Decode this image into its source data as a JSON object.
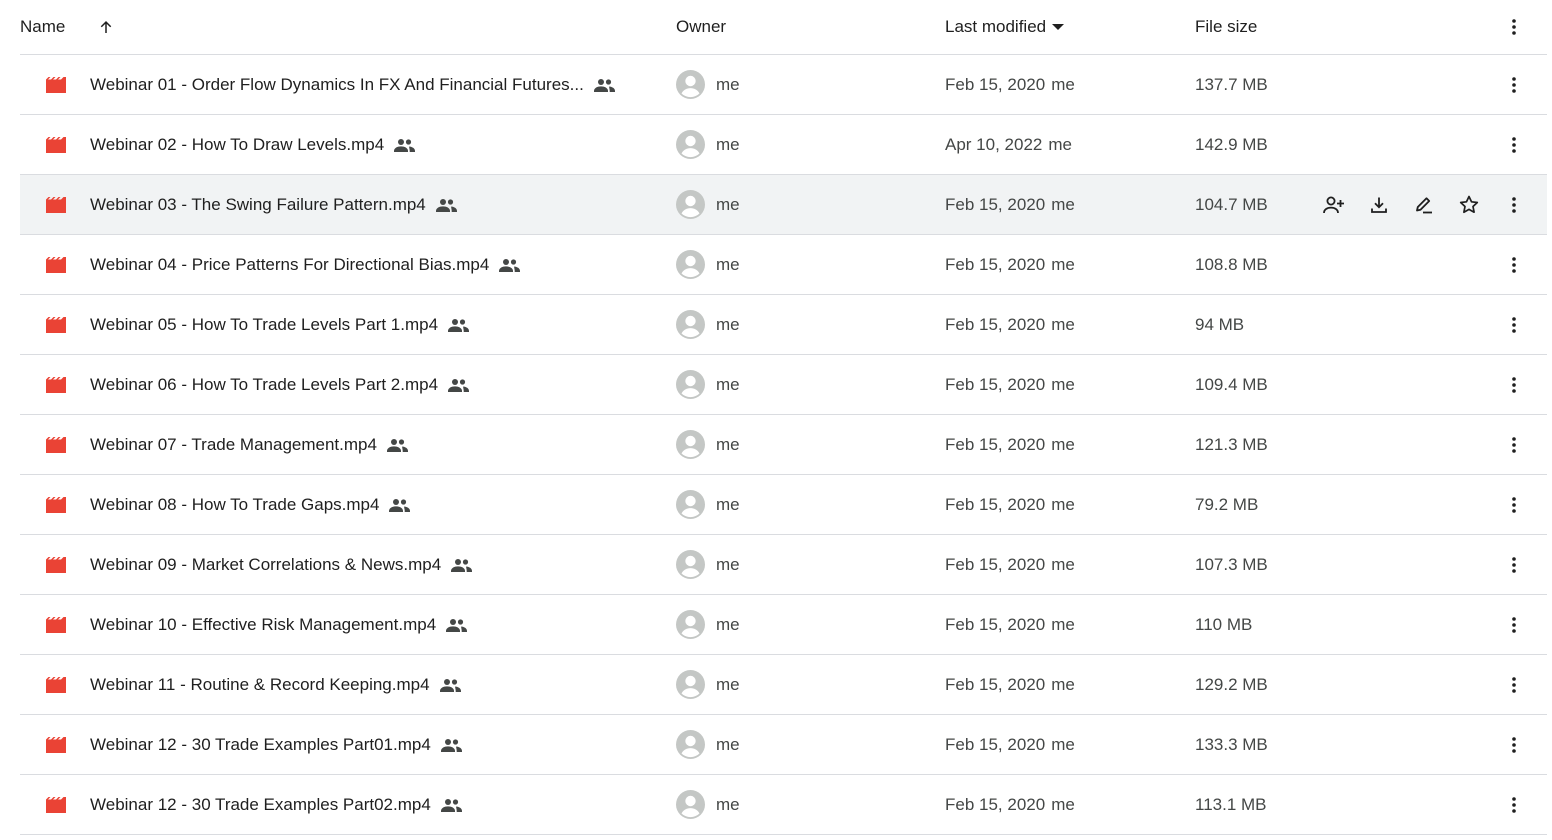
{
  "header": {
    "name_label": "Name",
    "owner_label": "Owner",
    "modified_label": "Last modified",
    "size_label": "File size",
    "sort_icon": "arrow-up-icon",
    "modified_dropdown_icon": "caret-down-icon",
    "more_icon": "more-vert-icon"
  },
  "colors": {
    "video_icon": "#ea4335",
    "row_hover_bg": "#f1f3f4",
    "divider": "#dadce0",
    "avatar": "#c4c7c5"
  },
  "files": [
    {
      "name": "Webinar 01 -  Order Flow Dynamics In FX And Financial Futures...",
      "owner": "me",
      "modified": "Feb 15, 2020",
      "modified_by": "me",
      "size": "137.7 MB"
    },
    {
      "name": "Webinar 02 - How To Draw Levels.mp4",
      "owner": "me",
      "modified": "Apr 10, 2022",
      "modified_by": "me",
      "size": "142.9 MB"
    },
    {
      "name": "Webinar 03 - The Swing Failure Pattern.mp4",
      "owner": "me",
      "modified": "Feb 15, 2020",
      "modified_by": "me",
      "size": "104.7 MB",
      "hovered": true
    },
    {
      "name": "Webinar 04 - Price Patterns For Directional Bias.mp4",
      "owner": "me",
      "modified": "Feb 15, 2020",
      "modified_by": "me",
      "size": "108.8 MB"
    },
    {
      "name": "Webinar 05 - How To Trade Levels Part 1.mp4",
      "owner": "me",
      "modified": "Feb 15, 2020",
      "modified_by": "me",
      "size": "94 MB"
    },
    {
      "name": "Webinar 06 - How To Trade Levels Part 2.mp4",
      "owner": "me",
      "modified": "Feb 15, 2020",
      "modified_by": "me",
      "size": "109.4 MB"
    },
    {
      "name": "Webinar 07 - Trade Management.mp4",
      "owner": "me",
      "modified": "Feb 15, 2020",
      "modified_by": "me",
      "size": "121.3 MB"
    },
    {
      "name": "Webinar 08 - How To Trade Gaps.mp4",
      "owner": "me",
      "modified": "Feb 15, 2020",
      "modified_by": "me",
      "size": "79.2 MB"
    },
    {
      "name": "Webinar 09 - Market Correlations & News.mp4",
      "owner": "me",
      "modified": "Feb 15, 2020",
      "modified_by": "me",
      "size": "107.3 MB"
    },
    {
      "name": "Webinar 10 - Effective Risk Management.mp4",
      "owner": "me",
      "modified": "Feb 15, 2020",
      "modified_by": "me",
      "size": "110 MB"
    },
    {
      "name": "Webinar 11 - Routine & Record Keeping.mp4",
      "owner": "me",
      "modified": "Feb 15, 2020",
      "modified_by": "me",
      "size": "129.2 MB"
    },
    {
      "name": "Webinar 12 - 30 Trade Examples Part01.mp4",
      "owner": "me",
      "modified": "Feb 15, 2020",
      "modified_by": "me",
      "size": "133.3 MB"
    },
    {
      "name": "Webinar 12 - 30 Trade Examples Part02.mp4",
      "owner": "me",
      "modified": "Feb 15, 2020",
      "modified_by": "me",
      "size": "113.1 MB"
    }
  ],
  "row_icons": {
    "file": "video-file-icon",
    "shared": "shared-people-icon",
    "avatar": "person-avatar-icon",
    "hover_actions": [
      "share-person-add-icon",
      "download-icon",
      "rename-pencil-icon",
      "star-icon"
    ],
    "more": "more-vert-icon"
  }
}
